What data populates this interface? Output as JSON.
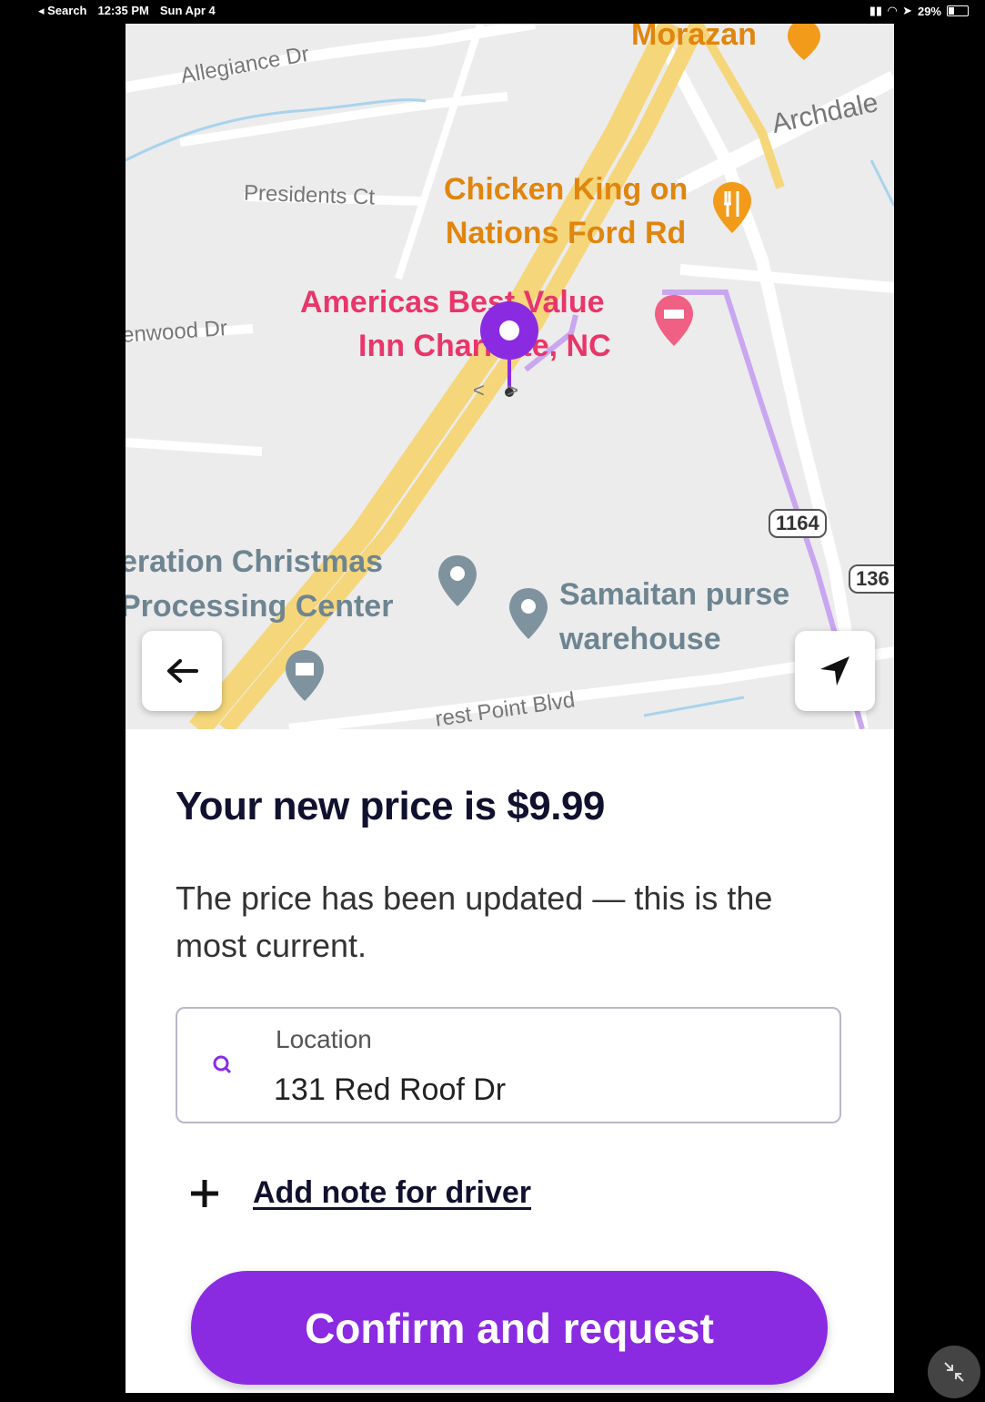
{
  "status_bar": {
    "back_app": "◂ Search",
    "time": "12:35 PM",
    "date": "Sun Apr 4",
    "battery": "29%"
  },
  "map": {
    "streets": {
      "allegiance": "Allegiance Dr",
      "presidents": "Presidents Ct",
      "archdale": "Archdale",
      "wood": "enwood Dr",
      "point_blvd": "rest Point Blvd"
    },
    "pois": {
      "morazan": "Morazan",
      "chicken_king": "Chicken King on\nNations Ford Rd",
      "americas_best_line1": "Americas Best Value",
      "americas_best_line2": "Inn Charlotte, NC",
      "operation_christmas_line1": "eration Christmas",
      "operation_christmas_line2": "Processing Center",
      "samaritan_line1": "Samaitan purse",
      "samaritan_line2": "warehouse"
    },
    "shields": {
      "route_1164": "1164",
      "route_136": "136"
    }
  },
  "sheet": {
    "title": "Your new price is $9.99",
    "subtitle": "The price has been updated — this is the most current.",
    "location_label": "Location",
    "location_value": "131 Red Roof Dr",
    "add_note": "Add note for driver",
    "confirm_button": "Confirm and request"
  },
  "colors": {
    "accent": "#8a2be2",
    "title": "#10112e",
    "food_poi": "#e0850e",
    "hotel_poi": "#e8366a",
    "highway": "#f5d67a"
  },
  "icons": [
    "back-arrow-icon",
    "navigate-arrow-icon",
    "search-q-icon",
    "plus-icon",
    "map-pin-icon",
    "fork-knife-icon",
    "hotel-bed-icon",
    "landmark-icon",
    "collapse-icon"
  ]
}
